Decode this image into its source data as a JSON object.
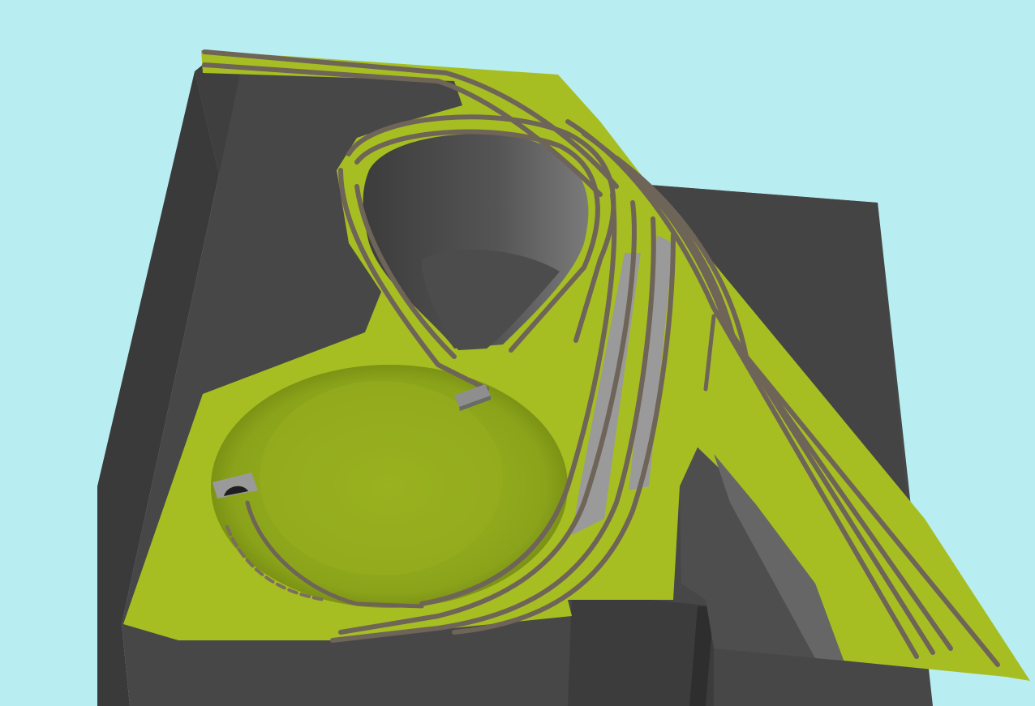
{
  "scene": {
    "kind": "3d-model-railway-layout",
    "colors": {
      "sky": "#b8eef2",
      "base_dark": "#4a4a4a",
      "base_darker": "#3a3a3a",
      "wall_light": "#6e6e6e",
      "grass": "#a6be22",
      "grass_dark": "#7f9412",
      "platform": "#9a9a9a",
      "track_rail": "#6e6458",
      "track_tie": "#8a7a66"
    },
    "elements": {
      "baseboard": "grey-baseboard",
      "terrain": "green-terrain",
      "tracks": "railway-tracks",
      "platforms": "station-platforms",
      "tunnel_portal": "tunnel-portal",
      "bridge": "small-bridge"
    }
  }
}
